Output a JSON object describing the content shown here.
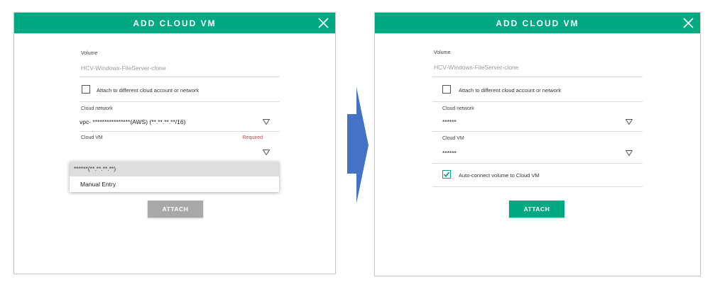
{
  "left_dialog": {
    "title": "ADD CLOUD VM",
    "volume_label": "Volume",
    "volume_value": "HCV-Windows-FileServer-clone",
    "attach_different_label": "Attach to different cloud account or network",
    "cloud_network_label": "Cloud network",
    "cloud_network_value": "vpc- ****************(AWS) (**.**.**.**/16)",
    "cloud_vm_label": "Cloud VM",
    "cloud_vm_required": "Required",
    "cloud_vm_options": [
      "******(**.**.**.**)",
      "Manual Entry"
    ],
    "attach_button": "ATTACH"
  },
  "right_dialog": {
    "title": "ADD CLOUD VM",
    "volume_label": "Volume",
    "volume_value": "HCV-Windows-FileServer-clone",
    "attach_different_label": "Attach to different cloud account or network",
    "cloud_network_label": "Cloud network",
    "cloud_network_value": "******",
    "cloud_vm_label": "Cloud VM",
    "cloud_vm_value": "******",
    "auto_connect_label": "Auto-connect volume to Cloud VM",
    "auto_connect_checked": true,
    "attach_button": "ATTACH"
  },
  "colors": {
    "brand": "#01a982",
    "disabled_button": "#a8a8a8",
    "required": "#d93b3b",
    "arrow": "#4472c4"
  },
  "icons": {
    "close": "close-icon",
    "dropdown": "chevron-down-icon",
    "check": "checkmark-icon",
    "transition": "arrow-right-icon"
  }
}
